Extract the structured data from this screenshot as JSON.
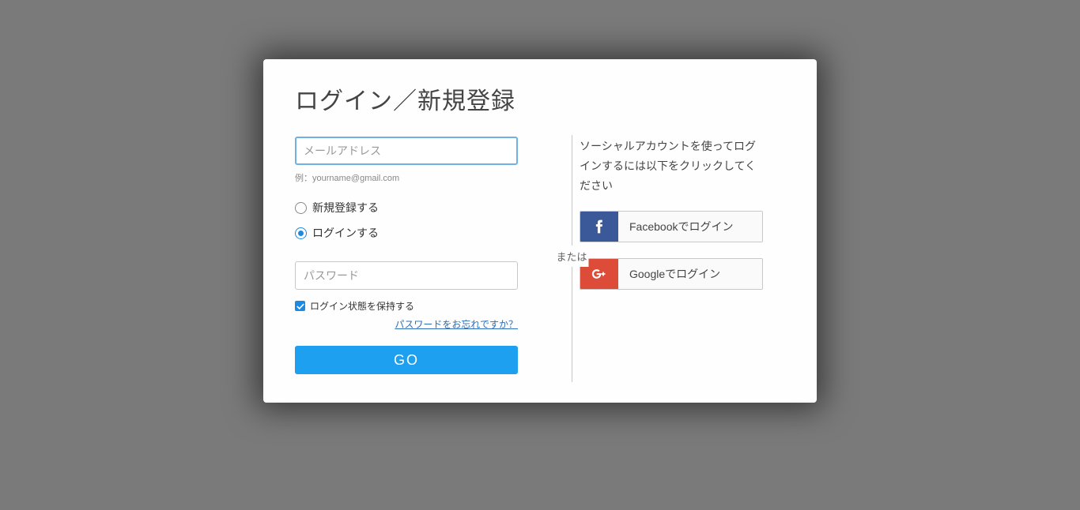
{
  "title": "ログイン／新規登録",
  "email": {
    "placeholder": "メールアドレス",
    "hint": "例：yourname@gmail.com"
  },
  "radios": {
    "register": "新規登録する",
    "login": "ログインする"
  },
  "password": {
    "placeholder": "パスワード"
  },
  "remember": "ログイン状態を保持する",
  "forgot": "パスワードをお忘れですか？",
  "go": "GO",
  "or": "または",
  "social": {
    "desc": "ソーシャルアカウントを使ってログインするには以下をクリックしてください",
    "facebook": "Facebookでログイン",
    "google": "Googleでログイン"
  }
}
